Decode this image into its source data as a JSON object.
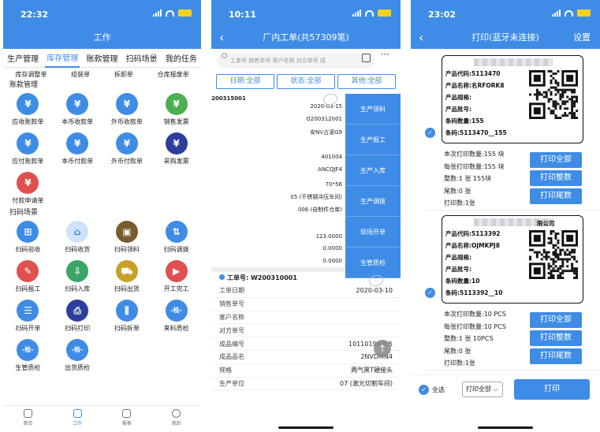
{
  "phone1": {
    "time": "22:32",
    "title": "工作",
    "tabs": [
      "生产管理",
      "库存管理",
      "账款管理",
      "扫码场景",
      "我的任务"
    ],
    "active_tab": 1,
    "subrow": [
      "库存调整单",
      "组装单",
      "拆卸单",
      "仓库报废单"
    ],
    "sections": [
      "账款管理",
      "扫码场景"
    ],
    "accounts": [
      {
        "label": "应收账款单",
        "icon": "receivable-icon",
        "color": "#3f8ce6"
      },
      {
        "label": "本币收款单",
        "icon": "receipt-icon",
        "color": "#3f8ce6"
      },
      {
        "label": "外币收款单",
        "icon": "foreign-receipt-icon",
        "color": "#3f8ce6"
      },
      {
        "label": "销售发票",
        "icon": "sales-invoice-icon",
        "color": "#4caf50"
      },
      {
        "label": "应付账款单",
        "icon": "payable-icon",
        "color": "#3f8ce6"
      },
      {
        "label": "本币付款单",
        "icon": "payment-icon",
        "color": "#3f8ce6"
      },
      {
        "label": "外币付款单",
        "icon": "foreign-payment-icon",
        "color": "#3f8ce6"
      },
      {
        "label": "采购发票",
        "icon": "purchase-invoice-icon",
        "color": "#2c3e9c"
      },
      {
        "label": "付款申请单",
        "icon": "payment-request-icon",
        "color": "#e05050"
      }
    ],
    "scans": [
      {
        "label": "扫码验收",
        "icon": "cart-icon",
        "color": "#3f8ce6",
        "glyph": "⊞"
      },
      {
        "label": "扫码收货",
        "icon": "warehouse-icon",
        "color": "#cfe2f7",
        "glyph": "⌂"
      },
      {
        "label": "扫码领料",
        "icon": "box-icon",
        "color": "#7a5b2e",
        "glyph": "▣"
      },
      {
        "label": "扫码调拨",
        "icon": "transfer-icon",
        "color": "#3f8ce6",
        "glyph": "⇅"
      },
      {
        "label": "扫码报工",
        "icon": "report-icon",
        "color": "#e05050",
        "glyph": "✎"
      },
      {
        "label": "扫码入库",
        "icon": "inbox-icon",
        "color": "#3aa565",
        "glyph": "⇩"
      },
      {
        "label": "扫码出货",
        "icon": "truck-icon",
        "color": "#c8a028",
        "glyph": "⛟"
      },
      {
        "label": "开工完工",
        "icon": "start-finish-icon",
        "color": "#e05050",
        "glyph": "▶"
      },
      {
        "label": "扫码开单",
        "icon": "create-order-icon",
        "color": "#3f8ce6",
        "glyph": "☰"
      },
      {
        "label": "扫码打印",
        "icon": "print-icon",
        "color": "#2c3e9c",
        "glyph": "⎙"
      },
      {
        "label": "扫码拆单",
        "icon": "split-icon",
        "color": "#3f8ce6",
        "glyph": "⫼"
      },
      {
        "label": "来料质检",
        "icon": "incoming-inspect-icon",
        "color": "#3f8ce6",
        "glyph": "-检-"
      },
      {
        "label": "生管质检",
        "icon": "production-inspect-icon",
        "color": "#3f8ce6",
        "glyph": "-检-"
      },
      {
        "label": "出货质检",
        "icon": "shipping-inspect-icon",
        "color": "#3f8ce6",
        "glyph": "-检-"
      }
    ],
    "nav": [
      "首页",
      "工作",
      "报表",
      "我的"
    ],
    "nav_active": 1
  },
  "phone2": {
    "time": "10:11",
    "title": "厂内工单(共57309笔)",
    "search_placeholder": "工单号 销售单号 客户名称 对方单号 成",
    "more": "···",
    "filters": [
      "日期:全部",
      "状态:全部",
      "其他:全部"
    ],
    "card1": {
      "id": "200315001",
      "values": [
        "2020-03-15",
        "O200312001",
        "安NV占滚G9",
        "401004",
        "ANCQJF4",
        "70*56",
        "05 (不锈钢冲压车间)",
        "006 (自制件仓库)",
        "123.0000",
        "0.0000",
        "0.0000"
      ],
      "actions": [
        "生产领料",
        "生产报工",
        "生产入库",
        "生产调拨",
        "现场开单",
        "生管质检"
      ]
    },
    "card2": {
      "header": "工单号: W200310001",
      "rows": [
        {
          "k": "工单日期",
          "v": "2020-03-10"
        },
        {
          "k": "销售单号",
          "v": ""
        },
        {
          "k": "客户名称",
          "v": ""
        },
        {
          "k": "对方单号",
          "v": ""
        },
        {
          "k": "成品编号",
          "v": "10110199005"
        },
        {
          "k": "成品品名",
          "v": "2NVDMN4"
        },
        {
          "k": "规格",
          "v": "两气黑T硬接头"
        },
        {
          "k": "生产单位",
          "v": "07 (激光切割车间)"
        }
      ]
    }
  },
  "phone3": {
    "time": "23:02",
    "title": "打印(蓝牙未连接)",
    "settings": "设置",
    "labels": [
      {
        "company": "",
        "lines": [
          "产品代码:5113470",
          "产品名称:名RFORK8",
          "产品规格:",
          "产品批号:",
          "条码数量:155",
          "条码:5113470__155"
        ],
        "info": [
          "本次打印数量:155     块",
          "每张打印数量:155  块",
          "整数:1      张   155块",
          "尾数:0       张",
          "打印数:1张"
        ],
        "buttons": [
          "打印全部",
          "打印整数",
          "打印尾数"
        ]
      },
      {
        "company": "限公司",
        "lines": [
          "产品代码:5113392",
          "产品名称:OJMKPJ8",
          "产品规格:",
          "产品批号:",
          "条码数量:10",
          "条码:5113392__10"
        ],
        "info": [
          "本次打印数量:10        PCS",
          "每张打印数量:10        PCS",
          "整数:1      张  10PCS",
          "尾数:0       张",
          "打印数:1张"
        ],
        "buttons": [
          "打印全部",
          "打印整数",
          "打印尾数"
        ]
      }
    ],
    "select_all": "全选",
    "print_mode": "打印全部",
    "print_button": "打印"
  }
}
